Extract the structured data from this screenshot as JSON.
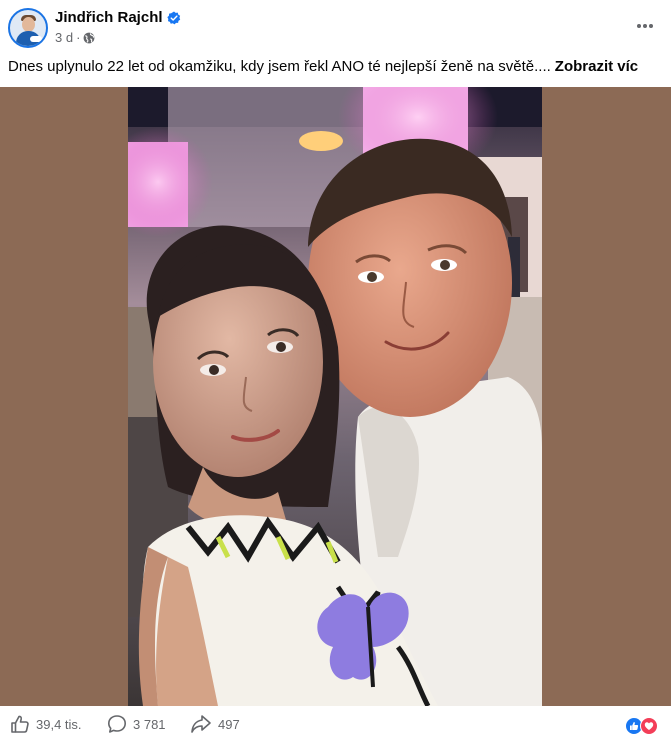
{
  "post": {
    "author": "Jindřich Rajchl",
    "time_ago": "3 d",
    "dot": "·",
    "caption": "Dnes uplynulo 22 let od okamžiku, kdy jsem řekl ANO té nejlepší ženě na světě....",
    "see_more": "Zobrazit víc",
    "verified_icon": "verified-badge-icon",
    "audience_icon": "globe-icon",
    "menu_icon": "more-dots-icon"
  },
  "photo": {
    "background_color": "#8c6a55"
  },
  "footer": {
    "likes": "39,4 tis.",
    "comments": "3 781",
    "shares": "497",
    "reactions": [
      "like",
      "love"
    ]
  },
  "colors": {
    "accent": "#1877f2",
    "love": "#f33e58",
    "meta_text": "#65676b"
  }
}
